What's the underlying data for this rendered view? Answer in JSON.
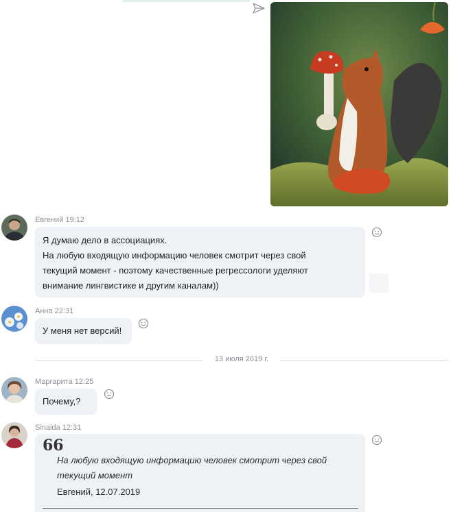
{
  "messages": [
    {
      "author": "Евгений",
      "time": "19:12",
      "lines": [
        "Я думаю дело в ассоциациях.",
        "На любую входящую информацию человек смотрит через свой",
        "текущий момент - поэтому качественные регрессологи уделяют",
        "внимание лингвистике и другим каналам))"
      ]
    },
    {
      "author": "Анна",
      "time": "22:31",
      "text": "У меня нет версий!"
    },
    {
      "author": "Маргарита",
      "time": "12:25",
      "text": "Почему,?"
    },
    {
      "author": "Sinaida",
      "time": "12:31",
      "quote": {
        "mark": "66",
        "lines": [
          "На любую входящую информацию человек смотрит через свой",
          "текущий момент"
        ],
        "author": "Евгений, 12.07.2019"
      }
    }
  ],
  "date_separator": "13 июля 2019 г.",
  "icons": {
    "sent": "paper-plane-icon",
    "reaction": "smiley-icon"
  },
  "colors": {
    "bubble": "#eef1f5",
    "meta_text": "#8a8f96",
    "divider": "#d9dde2"
  }
}
